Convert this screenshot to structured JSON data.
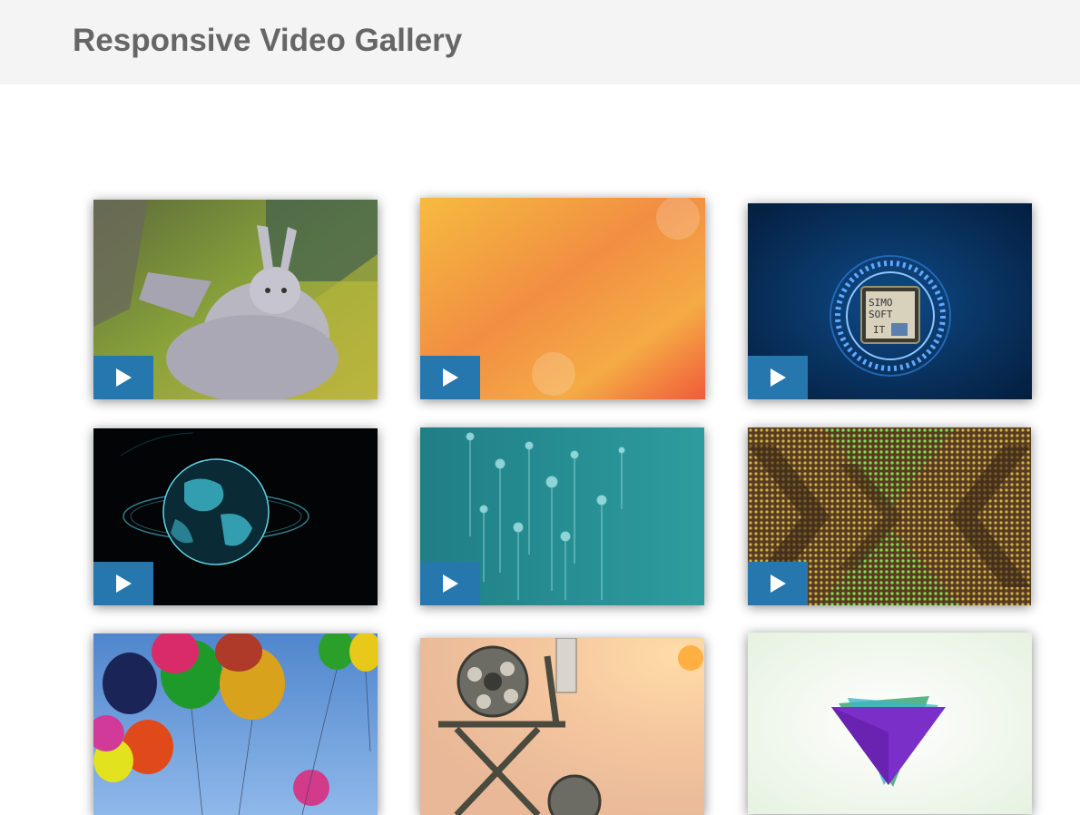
{
  "header": {
    "title": "Responsive Video Gallery"
  },
  "videos": [
    {
      "thumbnail": "big-buck-bunny-scene",
      "play_icon": "play-icon"
    },
    {
      "thumbnail": "orange-gradient-bokeh",
      "play_icon": "play-icon"
    },
    {
      "thumbnail": "simo-soft-it-chip-logo",
      "thumb_text": [
        "SIMO",
        "SOFT",
        "IT"
      ],
      "play_icon": "play-icon"
    },
    {
      "thumbnail": "holographic-earth-globe",
      "play_icon": "play-icon"
    },
    {
      "thumbnail": "teal-rising-bubbles",
      "play_icon": "play-icon"
    },
    {
      "thumbnail": "green-led-chevron-pattern",
      "play_icon": "play-icon"
    },
    {
      "thumbnail": "colorful-balloons-sky",
      "play_icon": "play-icon"
    },
    {
      "thumbnail": "film-reel-directors-chair",
      "play_icon": "play-icon"
    },
    {
      "thumbnail": "purple-triangle-logo",
      "play_icon": "play-icon"
    }
  ],
  "colors": {
    "header_bg": "#f4f4f4",
    "title_text": "#666666",
    "play_button": "#2577ae"
  }
}
